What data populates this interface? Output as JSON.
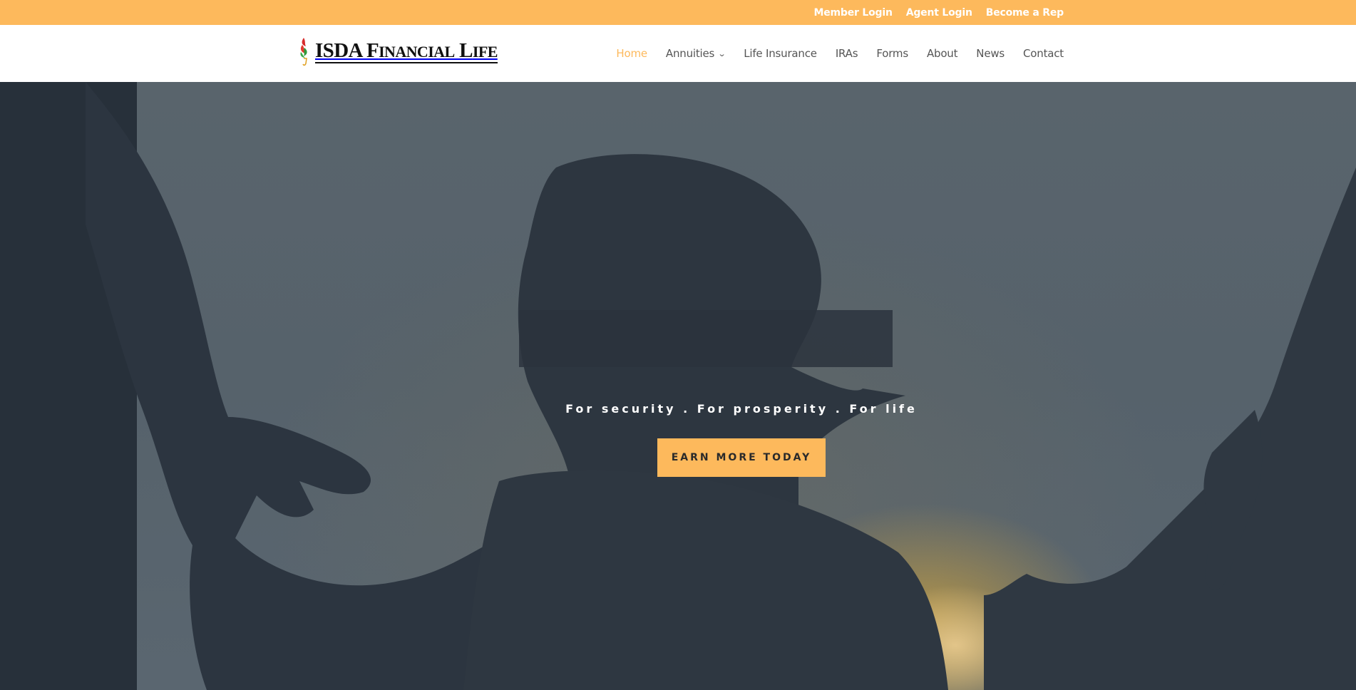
{
  "topbar": {
    "links": [
      "Member Login",
      "Agent Login",
      "Become a Rep"
    ]
  },
  "header": {
    "logo_text_main": "ISDA F",
    "logo_text_sc1": "INANCIAL",
    "logo_text_mid": " L",
    "logo_text_sc2": "IFE"
  },
  "nav": {
    "items": [
      {
        "label": "Home",
        "active": true
      },
      {
        "label": "Annuities",
        "dropdown": true
      },
      {
        "label": "Life Insurance"
      },
      {
        "label": "IRAs"
      },
      {
        "label": "Forms"
      },
      {
        "label": "About"
      },
      {
        "label": "News"
      },
      {
        "label": "Contact"
      }
    ],
    "active_color": "#fdb95c"
  },
  "hero": {
    "tagline": "For security . For prosperity . For life",
    "cta_label": "EARN MORE TODAY"
  },
  "colors": {
    "accent": "#fdb95c",
    "hero_overlay": "#2a323b"
  },
  "icons": {
    "logo_mark": "torch-flame-icon",
    "annuities_dropdown": "chevron-down-icon"
  }
}
